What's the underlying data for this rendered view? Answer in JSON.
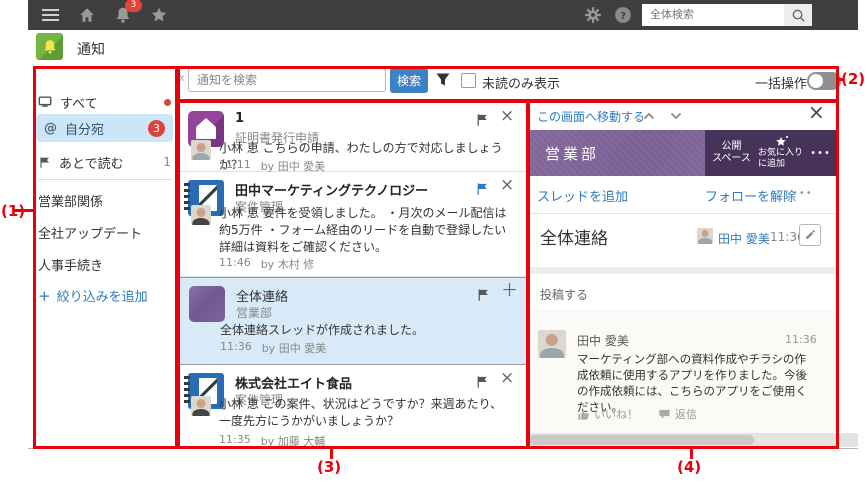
{
  "topbar": {
    "bell_badge": "3",
    "search_placeholder": "全体検索"
  },
  "app_header": {
    "title": "通知"
  },
  "sidebar": {
    "all": {
      "label": "すべて"
    },
    "mine": {
      "label": "自分宛",
      "badge": "3"
    },
    "later": {
      "label": "あとで読む",
      "count": "1"
    },
    "filters": [
      {
        "label": "営業部関係"
      },
      {
        "label": "全社アップデート"
      },
      {
        "label": "人事手続き"
      }
    ],
    "add_filter": {
      "label": "絞り込みを追加"
    }
  },
  "toolbar": {
    "search_placeholder": "通知を検索",
    "search_button": "検索",
    "unread_label": "未読のみ表示",
    "bulk_label": "一括操作"
  },
  "notifications": [
    {
      "title": "1",
      "subtitle": "証明書発行申請",
      "message": "小林 恵 こちらの申請、わたしの方で対応しましょうか？",
      "time": "11:11",
      "by": "by 田中 愛美"
    },
    {
      "title": "田中マーケティングテクノロジー",
      "subtitle": "案件管理",
      "message": "小林 恵 要件を受領しました。 ・月次のメール配信は約5万件 ・フォーム経由のリードを自動で登録したい 詳細は資料をご確認ください。",
      "time": "11:46",
      "by": "by 木村 修"
    },
    {
      "title": "全体連絡",
      "subtitle": "営業部",
      "message": "全体連絡スレッドが作成されました。",
      "time": "11:36",
      "by": "by 田中 愛美"
    },
    {
      "title": "株式会社エイト食品",
      "subtitle": "案件管理",
      "message": "小林 恵 この案件、状況はどうですか？来週あたり、一度先方にうかがいましょうか？",
      "time": "11:35",
      "by": "by 加藤 大輔"
    }
  ],
  "preview": {
    "goto_label": "この画面へ移動する",
    "space_name": "営業部",
    "public_space": "公開\nスペース",
    "add_favorite": "お気に入り\nに追加",
    "add_thread": "スレッドを追加",
    "unfollow": "フォローを解除",
    "thread": {
      "title": "全体連絡",
      "author": "田中 愛美",
      "time": "11:36"
    },
    "post_placeholder": "投稿する",
    "post": {
      "author": "田中 愛美",
      "time": "11:36",
      "body": "マーケティング部への資料作成やチラシの作成依頼に使用するアプリを作りました。今後の作成依頼には、こちらのアプリをご使用ください。",
      "like_label": "いいね！",
      "reply_label": "返信"
    }
  },
  "icons": {
    "close": "×",
    "plus": "＋",
    "at": "@",
    "collapse": "«",
    "more_dots": "•••"
  },
  "annotations": {
    "a1": "(1)",
    "a2": "(2)",
    "a3": "(3)",
    "a4": "(4)"
  },
  "colors": {
    "annotation_red": "#e8000d",
    "accent_blue": "#2e7bbd",
    "button_blue": "#3c82c4",
    "badge_red": "#d9453c",
    "banner_purple": "#7c6298",
    "selected_row": "#d8eaf8",
    "topbar_gray": "#3f3f3f"
  }
}
